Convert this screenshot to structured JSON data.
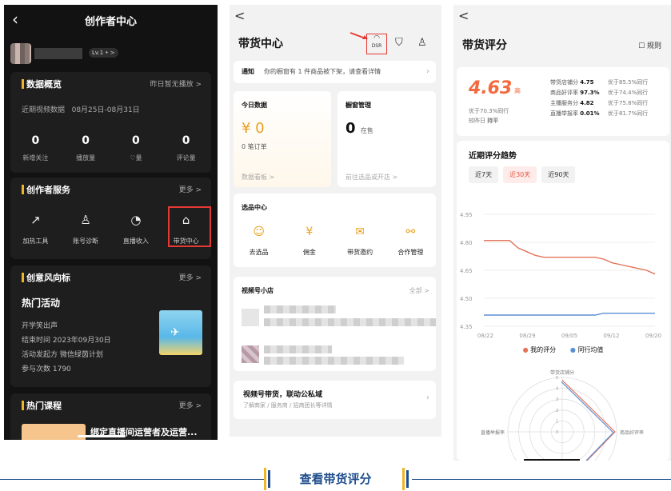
{
  "panel1": {
    "title": "创作者中心",
    "level": "Lv.1 • >",
    "data_overview": {
      "title": "数据概览",
      "status": "昨日暂无播放 >",
      "period_label": "近期视频数据",
      "period": "08月25日-08月31日",
      "stats": [
        {
          "value": "0",
          "label": "新增关注"
        },
        {
          "value": "0",
          "label": "播放量"
        },
        {
          "value": "0",
          "label": "♡量"
        },
        {
          "value": "0",
          "label": "评论量"
        }
      ]
    },
    "services": {
      "title": "创作者服务",
      "more": "更多 >",
      "items": [
        {
          "icon": "↗",
          "label": "加热工具"
        },
        {
          "icon": "♙",
          "label": "账号诊断"
        },
        {
          "icon": "◔",
          "label": "直播收入"
        },
        {
          "icon": "⌂",
          "label": "带货中心"
        }
      ]
    },
    "trends": {
      "title": "创意风向标",
      "more": "更多 >",
      "hot_title": "热门活动",
      "activity_name": "开学笑出声",
      "end_time": "结束时间  2023年09月30日",
      "initiator": "活动发起方  微信绿茵计划",
      "participants": "参与次数  1790"
    },
    "courses": {
      "title": "热门课程",
      "more": "更多 >",
      "course_title": "绑定直播间运营者及运营..."
    }
  },
  "panel2": {
    "back": "<",
    "title": "带货中心",
    "dsr_label": "DSR",
    "notice_label": "通知",
    "notice_text": "你的橱窗有 1 件商品被下架，请查看详情",
    "today_title": "今日数据",
    "today_value": "¥ 0",
    "today_orders": "0 笔订单",
    "today_link": "数据看板 >",
    "shelf_title": "橱窗管理",
    "shelf_value": "0",
    "shelf_unit": "在售",
    "shelf_link": "前往选品或开店 >",
    "selection_title": "选品中心",
    "selection_items": [
      {
        "icon": "☺",
        "label": "去选品"
      },
      {
        "icon": "¥",
        "label": "佣金"
      },
      {
        "icon": "✉",
        "label": "带货邀约"
      },
      {
        "icon": "⚯",
        "label": "合作管理"
      }
    ],
    "shop_title": "视频号小店",
    "shop_all": "全部 >",
    "promo_title": "视频号带货，联动公私域",
    "promo_sub": "了解商家 / 服务商 / 招商团长等详情"
  },
  "panel3": {
    "back": "<",
    "title": "带货评分",
    "rules": "☐ 规则",
    "score": "4.63",
    "score_tag": "高",
    "compare_peers": "优于70.3%同行",
    "compare_yesterday_label": "较昨日",
    "compare_yesterday": "持平",
    "metrics": [
      {
        "name": "带货店铺分",
        "value": "4.75",
        "pct": "优于85.5%同行"
      },
      {
        "name": "商品好评率",
        "value": "97.3%",
        "pct": "优于74.4%同行"
      },
      {
        "name": "主播服务分",
        "value": "4.82",
        "pct": "优于75.8%同行"
      },
      {
        "name": "直播举报率",
        "value": "0.01%",
        "pct": "优于81.7%同行"
      }
    ],
    "trend_title": "近期评分趋势",
    "tabs": [
      {
        "label": "近7天",
        "active": false
      },
      {
        "label": "近30天",
        "active": true
      },
      {
        "label": "近90天",
        "active": false
      }
    ],
    "legend": [
      {
        "name": "我的评分",
        "color": "#e5735a"
      },
      {
        "name": "同行均值",
        "color": "#5b8fd6"
      }
    ],
    "radar_labels": {
      "top": "带货店铺分",
      "right": "商品好评率",
      "left": "直播举报率"
    },
    "radar_ticks": [
      "5",
      "4",
      "3",
      "2",
      "1",
      "0"
    ]
  },
  "chart_data": {
    "type": "line",
    "x_ticks": [
      "08/22",
      "08/29",
      "09/05",
      "09/12",
      "09/20"
    ],
    "y_ticks": [
      "4.95",
      "4.80",
      "4.65",
      "4.50",
      "4.35"
    ],
    "ylim": [
      4.35,
      4.95
    ],
    "series": [
      {
        "name": "我的评分",
        "color": "#e5735a",
        "values": [
          4.81,
          4.81,
          4.81,
          4.81,
          4.77,
          4.75,
          4.73,
          4.72,
          4.72,
          4.72,
          4.72,
          4.72,
          4.72,
          4.72,
          4.71,
          4.69,
          4.68,
          4.67,
          4.66,
          4.65,
          4.63
        ]
      },
      {
        "name": "同行均值",
        "color": "#5b8fd6",
        "values": [
          4.41,
          4.41,
          4.41,
          4.41,
          4.41,
          4.41,
          4.41,
          4.41,
          4.41,
          4.41,
          4.41,
          4.41,
          4.41,
          4.41,
          4.42,
          4.42,
          4.42,
          4.42,
          4.42,
          4.42,
          4.42
        ]
      }
    ]
  },
  "caption": "查看带货评分"
}
